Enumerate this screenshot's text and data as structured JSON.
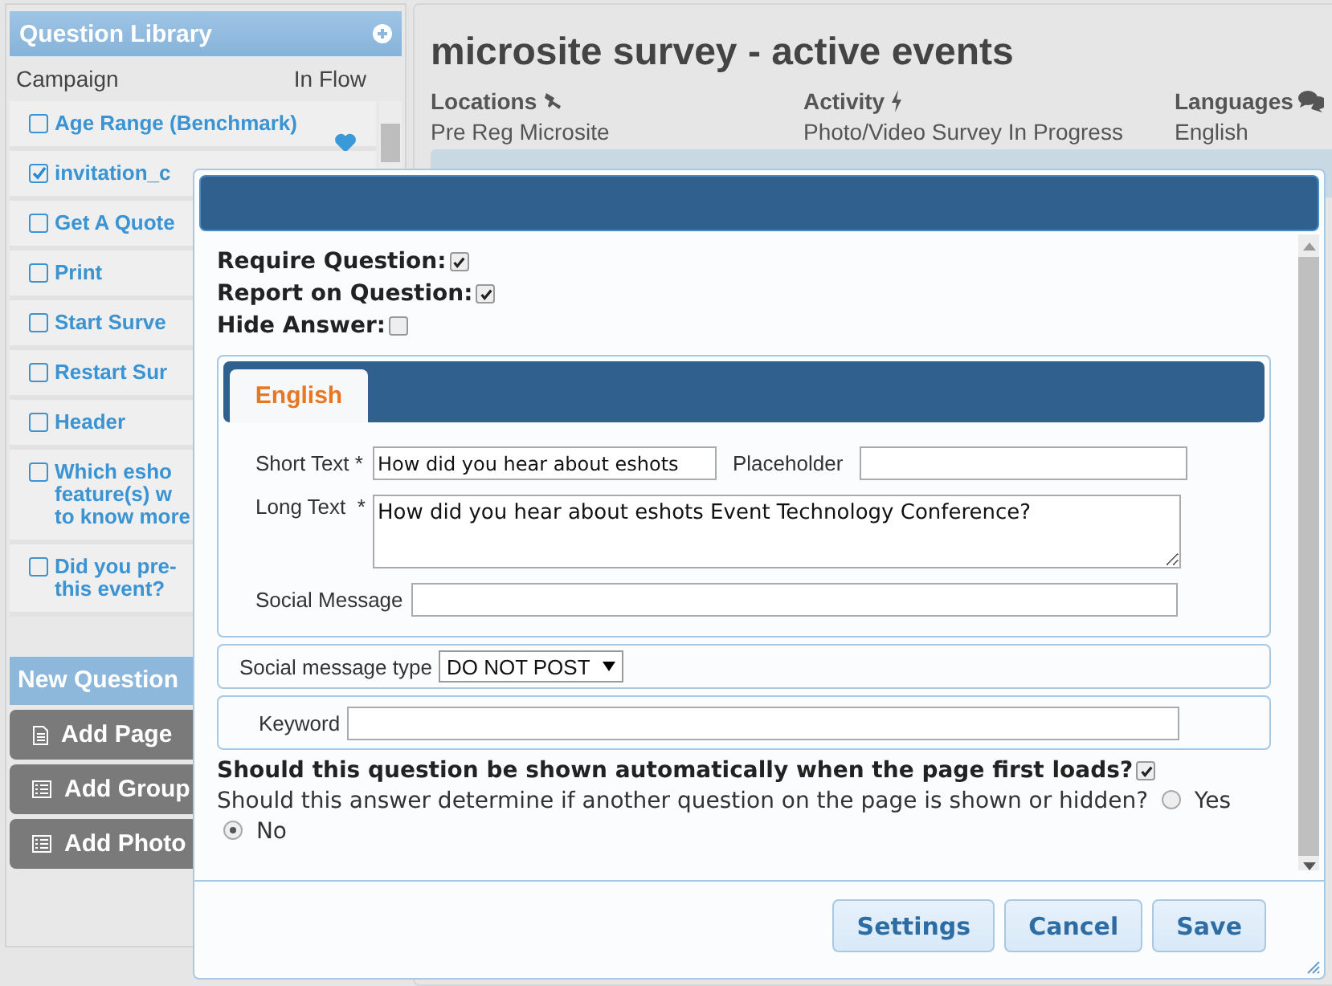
{
  "sidebar": {
    "title": "Question Library",
    "columns": [
      "Campaign",
      "In Flow"
    ],
    "items": [
      {
        "lines": [
          "Age Range (Benchmark)"
        ],
        "checked": false,
        "favorite": true
      },
      {
        "lines": [
          "invitation_c"
        ],
        "checked": true
      },
      {
        "lines": [
          "Get A Quote"
        ],
        "checked": false
      },
      {
        "lines": [
          "Print"
        ],
        "checked": false
      },
      {
        "lines": [
          "Start Surve"
        ],
        "checked": false
      },
      {
        "lines": [
          "Restart Sur"
        ],
        "checked": false
      },
      {
        "lines": [
          "Header"
        ],
        "checked": false
      },
      {
        "lines": [
          "Which esho",
          "feature(s) w",
          "to know more"
        ],
        "checked": false
      },
      {
        "lines": [
          "Did you pre-",
          "this event?"
        ],
        "checked": false
      }
    ],
    "new_question": {
      "title": "New Question",
      "buttons": [
        {
          "label": "Add Page"
        },
        {
          "label": "Add Group"
        },
        {
          "label": "Add Photo"
        }
      ]
    }
  },
  "page": {
    "title": "microsite survey - active events",
    "info": [
      {
        "label": "Locations",
        "value": "Pre Reg Microsite"
      },
      {
        "label": "Activity",
        "value": "Photo/Video Survey In Progress"
      },
      {
        "label": "Languages",
        "value": "English"
      }
    ]
  },
  "dialog": {
    "options": [
      {
        "label": "Require Question:",
        "checked": true
      },
      {
        "label": "Report on Question:",
        "checked": true
      },
      {
        "label": "Hide Answer:",
        "checked": false
      }
    ],
    "tabs": [
      {
        "label": "English",
        "selected": true
      }
    ],
    "short_text": {
      "label": "Short Text *",
      "value": "How did you hear about eshots"
    },
    "placeholder_field": {
      "label": "Placeholder"
    },
    "long_text": {
      "label": "Long Text  *",
      "value": "How did you hear about eshots Event Technology Conference?"
    },
    "social_message": {
      "label": "Social Message"
    },
    "social_message_type": {
      "label": "Social message type",
      "value": "DO NOT POST"
    },
    "keyword": {
      "label": "Keyword"
    },
    "auto_show": {
      "label": "Should this question be shown automatically when the page first loads?",
      "checked": true
    },
    "determine": {
      "label": "Should this answer determine if another question on the page is shown or hidden?",
      "options": [
        {
          "label": "Yes",
          "selected": false
        },
        {
          "label": "No",
          "selected": true
        }
      ]
    },
    "buttons": [
      "Settings",
      "Cancel",
      "Save"
    ]
  }
}
